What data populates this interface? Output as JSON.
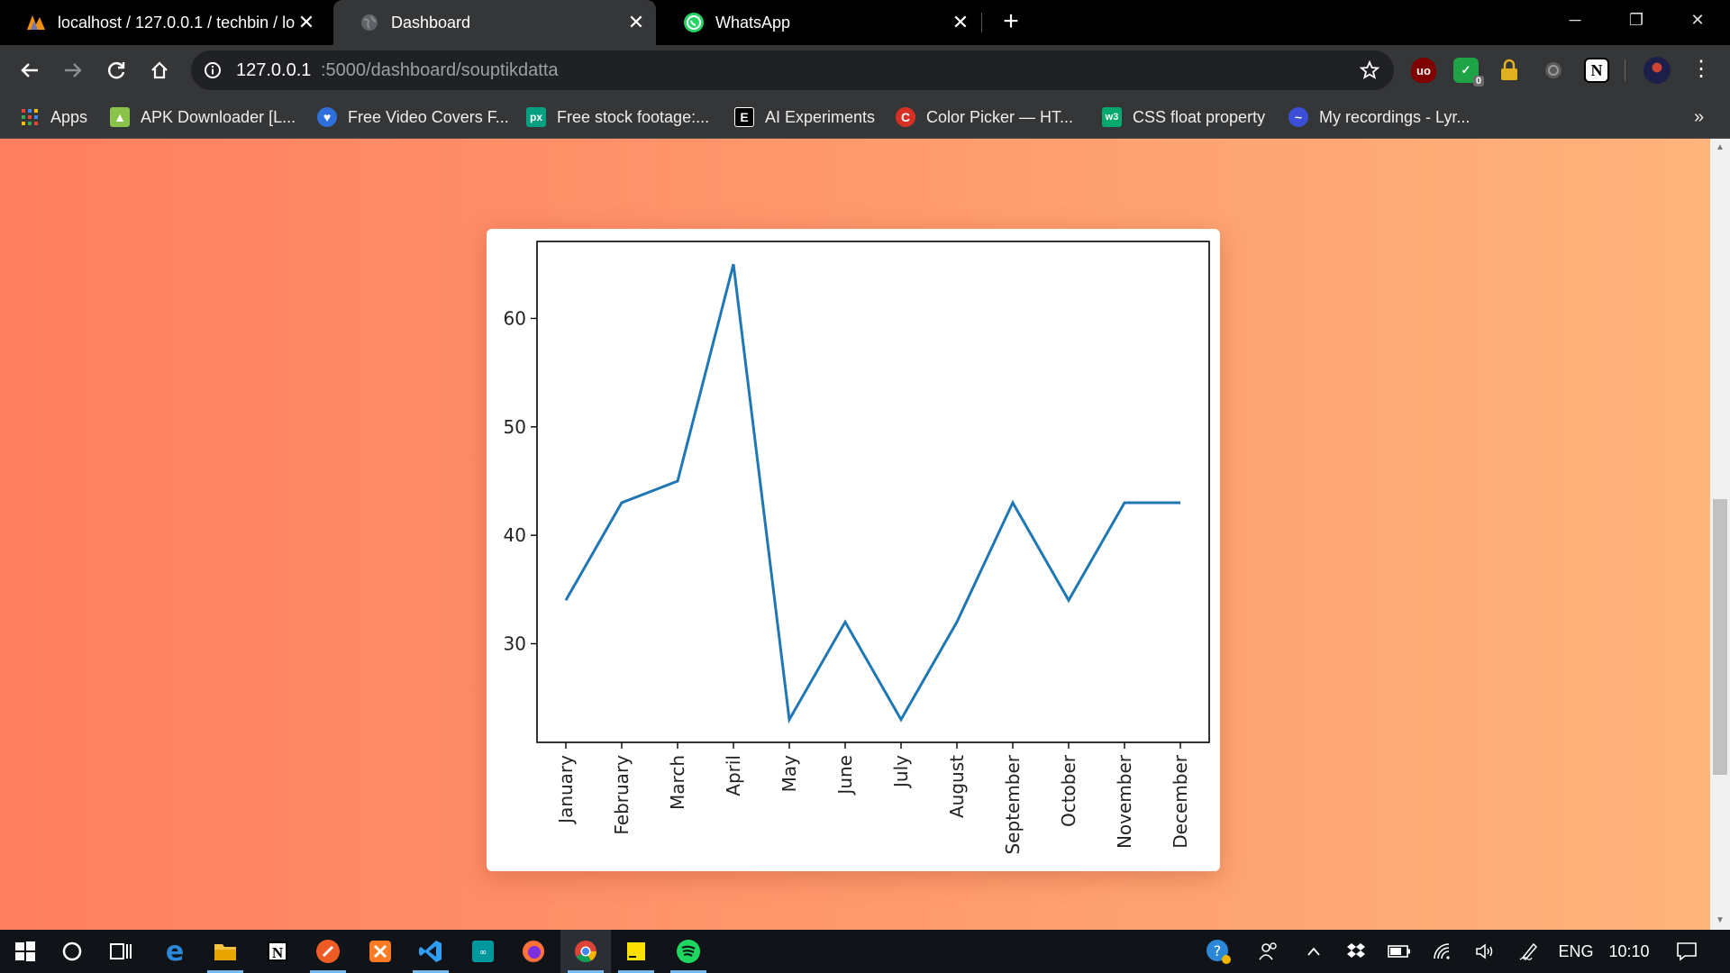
{
  "browser": {
    "tabs": [
      {
        "title": "localhost / 127.0.0.1 / techbin / lo",
        "icon": "phpmyadmin-icon",
        "active": false
      },
      {
        "title": "Dashboard",
        "icon": "globe-icon",
        "active": true
      },
      {
        "title": "WhatsApp",
        "icon": "whatsapp-icon",
        "active": false
      }
    ],
    "new_tab_label": "+",
    "window_controls": {
      "minimize": "─",
      "restore": "❐",
      "close": "✕"
    }
  },
  "toolbar": {
    "url_host": "127.0.0.1",
    "url_path": ":5000/dashboard/souptikdatta",
    "extensions": [
      {
        "name": "ublock-icon",
        "label": "uo",
        "color": "#800000"
      },
      {
        "name": "shield-check-icon",
        "label": "✓",
        "badge": "0",
        "color": "#1ea446"
      },
      {
        "name": "lock-icon",
        "label": "🔒",
        "color": "#e0b020"
      },
      {
        "name": "grammarly-icon",
        "label": "G",
        "color": "#555555"
      },
      {
        "name": "notion-icon",
        "label": "N",
        "color": "#ffffff"
      }
    ]
  },
  "bookmarks": [
    {
      "label": "Apps",
      "icon": "apps-grid-icon",
      "color": "#4285f4"
    },
    {
      "label": "APK Downloader [L...",
      "icon": "android-icon",
      "color": "#8bc34a"
    },
    {
      "label": "Free Video Covers F...",
      "icon": "heart-icon",
      "color": "#2f6fdb"
    },
    {
      "label": "Free stock footage:...",
      "icon": "pexels-icon",
      "color": "#05a081"
    },
    {
      "label": "AI Experiments",
      "icon": "e-icon",
      "color": "#000000"
    },
    {
      "label": "Color Picker — HT...",
      "icon": "color-picker-icon",
      "color": "#d93025"
    },
    {
      "label": "CSS float property",
      "icon": "w3-icon",
      "color": "#04aa6d"
    },
    {
      "label": "My recordings - Lyr...",
      "icon": "lyrebird-icon",
      "color": "#3b4fd8"
    }
  ],
  "bookmarks_overflow": "»",
  "chart_data": {
    "type": "line",
    "categories": [
      "January",
      "February",
      "March",
      "April",
      "May",
      "June",
      "July",
      "August",
      "September",
      "October",
      "November",
      "December"
    ],
    "values": [
      34,
      43,
      45,
      65,
      23,
      32,
      23,
      32,
      43,
      34,
      43,
      43
    ],
    "yticks": [
      30,
      40,
      50,
      60
    ],
    "ylim": [
      20.9,
      67.1
    ],
    "title": "",
    "xlabel": "",
    "ylabel": "",
    "grid": false,
    "line_color": "#1f77b4"
  },
  "taskbar": {
    "apps": [
      "windows-start-icon",
      "cortana-icon",
      "task-view-icon",
      "edge-icon",
      "file-explorer-icon",
      "notion-icon",
      "postman-icon",
      "xampp-icon",
      "vscode-icon",
      "arduino-icon",
      "firefox-icon",
      "chrome-icon",
      "sticky-notes-icon",
      "spotify-icon"
    ],
    "language": "ENG",
    "time": "10:10"
  }
}
